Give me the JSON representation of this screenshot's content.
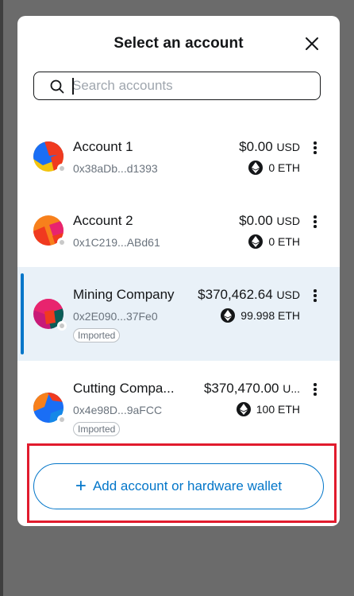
{
  "modal": {
    "title": "Select an account",
    "search": {
      "placeholder": "Search accounts",
      "value": ""
    },
    "add_button_label": "Add account or hardware wallet"
  },
  "accounts": [
    {
      "name": "Account 1",
      "address": "0x38aDb...d1393",
      "balance": "$0.00",
      "currency": "USD",
      "eth": "0 ETH",
      "tag": ""
    },
    {
      "name": "Account 2",
      "address": "0x1C219...ABd61",
      "balance": "$0.00",
      "currency": "USD",
      "eth": "0 ETH",
      "tag": ""
    },
    {
      "name": "Mining Company",
      "address": "0x2E090...37Fe0",
      "balance": "$370,462.64",
      "currency": "USD",
      "eth": "99.998 ETH",
      "tag": "Imported"
    },
    {
      "name": "Cutting Compa...",
      "address": "0x4e98D...9aFCC",
      "balance": "$370,470.00",
      "currency": "U...",
      "eth": "100 ETH",
      "tag": "Imported"
    }
  ],
  "colors": {
    "accent": "#0376c9",
    "highlight_border": "#e11b2d",
    "selected_bg": "#e9f1f8"
  },
  "icons": {
    "search": "search-icon",
    "close": "close-icon",
    "menu": "kebab-menu-icon",
    "eth": "ethereum-icon",
    "plus": "plus-icon"
  }
}
